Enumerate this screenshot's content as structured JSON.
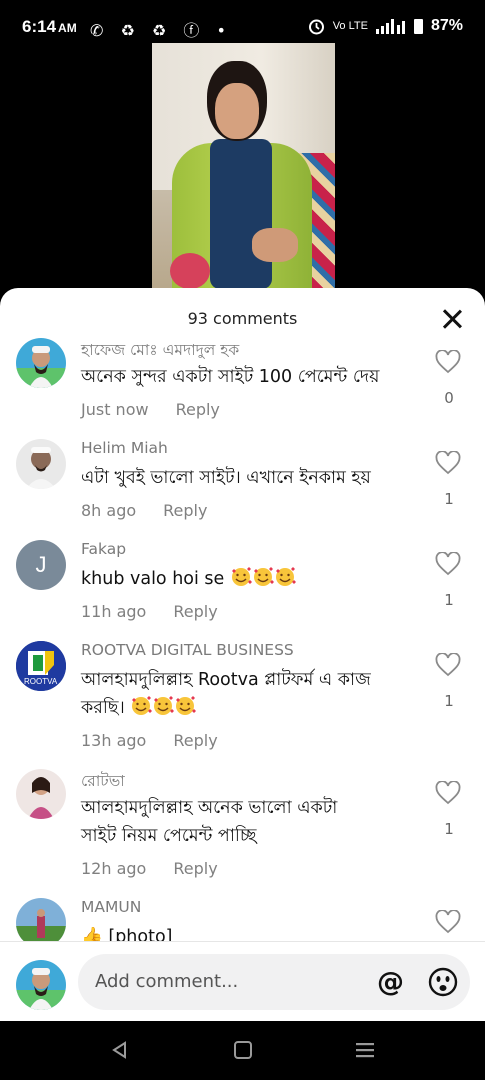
{
  "status_bar": {
    "time": "6:14",
    "ampm": "AM",
    "notification_icons": "✆ ♻ ♻ ⓕ •",
    "signal_text": "Vo LTE",
    "battery": "87%"
  },
  "comments_sheet": {
    "count_label": "93 comments",
    "comments": [
      {
        "author": "হাফেজ মোঃ এমদাদুল হক",
        "text": "অনেক সুন্দর একটা সাইট 100 পেমেন্ট দেয়",
        "time": "Just now",
        "reply_label": "Reply",
        "likes": "0"
      },
      {
        "author": "Helim Miah",
        "text": "এটা খুবই ভালো সাইট। এখানে ইনকাম হয়",
        "time": "8h ago",
        "reply_label": "Reply",
        "likes": "1"
      },
      {
        "author": "Fakap",
        "text": "khub valo hoi se",
        "avatar_letter": "J",
        "time": "11h ago",
        "reply_label": "Reply",
        "likes": "1"
      },
      {
        "author": "ROOTVA DIGITAL BUSINESS",
        "text_line1": "আলহামদুলিল্লাহ Rootva প্লাটফর্ম এ কাজ",
        "text_line2": "করছি।",
        "avatar_caption": "ROOTVA",
        "time": "13h ago",
        "reply_label": "Reply",
        "likes": "1"
      },
      {
        "author": "রোটভা",
        "text_line1": "আলহামদুলিল্লাহ অনেক ভালো একটা",
        "text_line2": "সাইট নিয়ম পেমেন্ট পাচ্ছি",
        "time": "12h ago",
        "reply_label": "Reply",
        "likes": "1"
      },
      {
        "author": "MAMUN",
        "text": "[photo]"
      }
    ],
    "composer": {
      "placeholder": "Add comment...",
      "at_symbol": "@"
    }
  },
  "colors": {
    "sheet_background": "#ffffff",
    "meta_text": "#808080",
    "avatar_letter_bg": "#7a8a99"
  }
}
